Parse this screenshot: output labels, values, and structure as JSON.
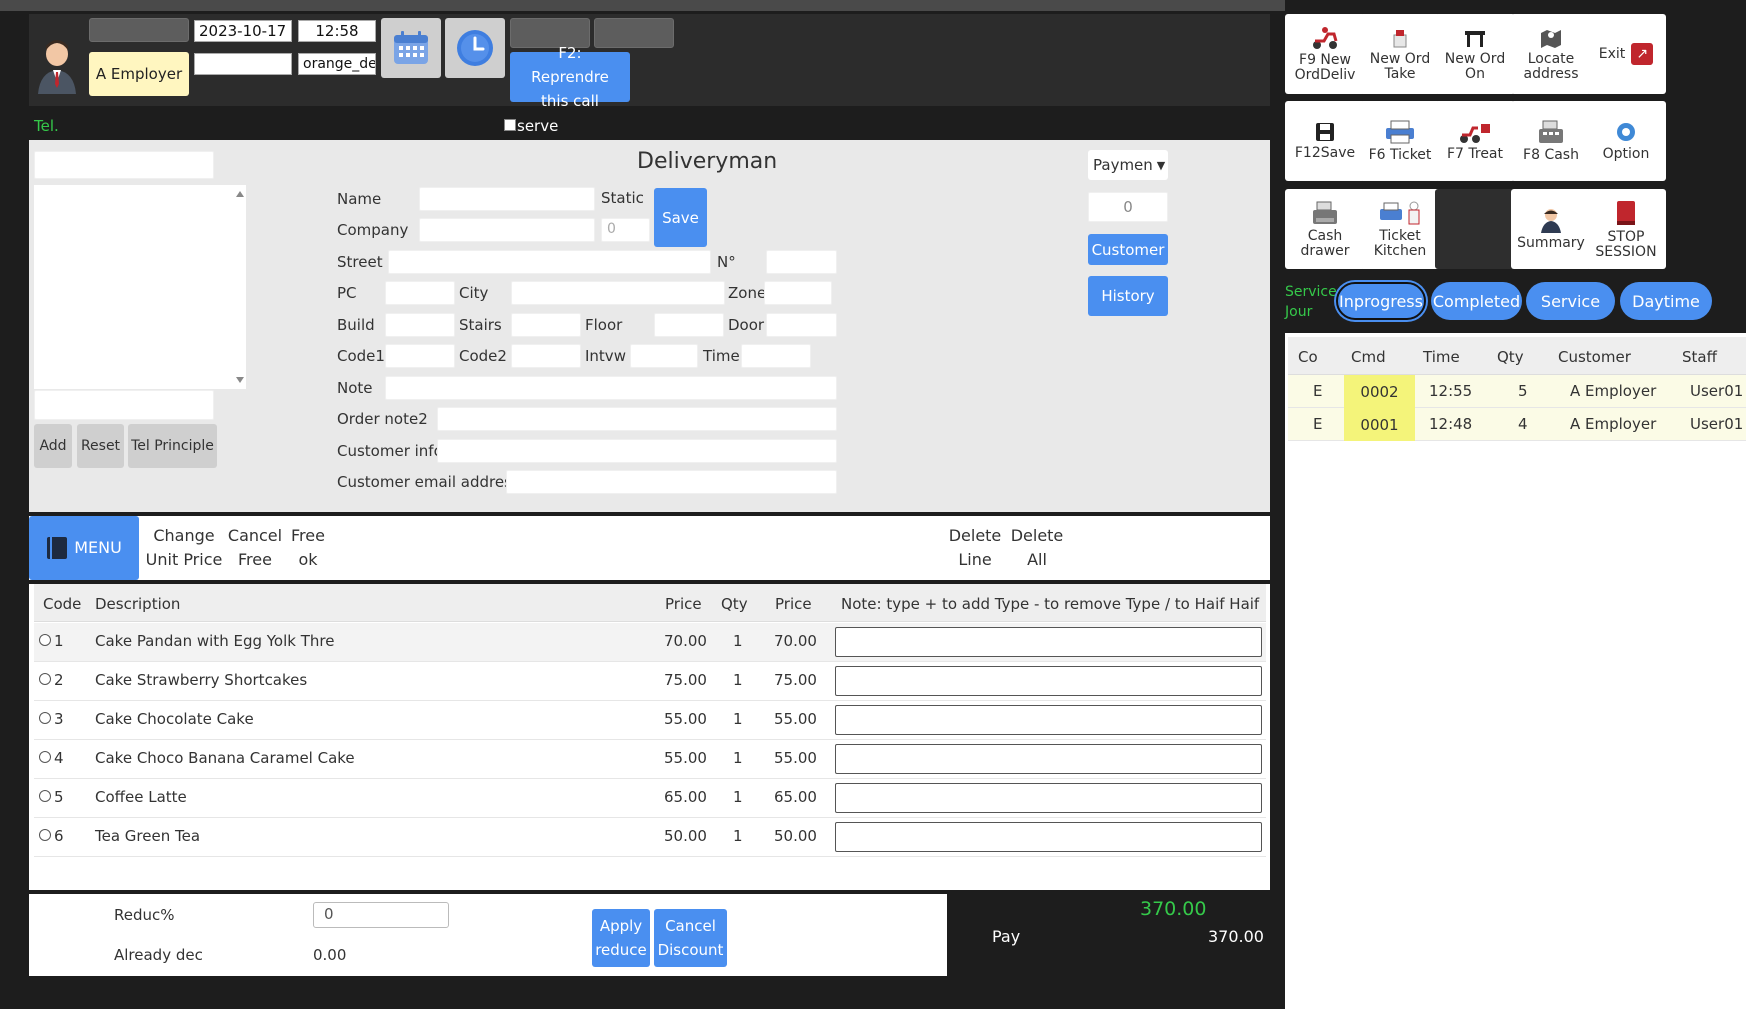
{
  "header": {
    "date": "2023-10-17",
    "time": "12:58",
    "employer": "A Employer",
    "source_value": "orange_de",
    "f2_label": "F2: Reprendre this call"
  },
  "phone": {
    "label": "Tel.",
    "reserve_label": "serve"
  },
  "form": {
    "title": "Deliveryman",
    "name_label": "Name",
    "static_label": "Static",
    "save_label": "Save",
    "company_label": "Company",
    "static_value_placeholder": "0",
    "street_label": "Street",
    "number_label": "N°",
    "pc_label": "PC",
    "city_label": "City",
    "zone_label": "Zone",
    "build_label": "Build",
    "stairs_label": "Stairs",
    "floor_label": "Floor",
    "door_label": "Door",
    "code1_label": "Code1",
    "code2_label": "Code2",
    "intvw_label": "Intvw",
    "time_label": "Time",
    "note_label": "Note",
    "order_note2_label": "Order note2",
    "customer_info_label": "Customer info",
    "customer_email_label": "Customer email address",
    "payment_select": "Paymen",
    "payment_value": "0",
    "customer_btn": "Customer",
    "history_btn": "History",
    "add_btn": "Add",
    "reset_btn": "Reset",
    "tel_principle_btn": "Tel Principle"
  },
  "menubar": {
    "menu_label": "MENU",
    "change_unit_price": [
      "Change",
      "Unit Price"
    ],
    "cancel_free": [
      "Cancel",
      "Free"
    ],
    "free_ok": [
      "Free",
      "ok"
    ],
    "delete_line": [
      "Delete",
      "Line"
    ],
    "delete_all": [
      "Delete",
      "All"
    ]
  },
  "items_table": {
    "headers": [
      "Code",
      "Description",
      "Price",
      "Qty",
      "Price",
      "Note: type + to add Type - to remove Type / to Haif Haif"
    ],
    "rows": [
      {
        "code": "1",
        "desc": "Cake Pandan with Egg Yolk Thre",
        "price": "70.00",
        "qty": "1",
        "total": "70.00"
      },
      {
        "code": "2",
        "desc": "Cake Strawberry Shortcakes",
        "price": "75.00",
        "qty": "1",
        "total": "75.00"
      },
      {
        "code": "3",
        "desc": "Cake Chocolate Cake",
        "price": "55.00",
        "qty": "1",
        "total": "55.00"
      },
      {
        "code": "4",
        "desc": "Cake Choco Banana Caramel Cake",
        "price": "55.00",
        "qty": "1",
        "total": "55.00"
      },
      {
        "code": "5",
        "desc": "Coffee Latte",
        "price": "65.00",
        "qty": "1",
        "total": "65.00"
      },
      {
        "code": "6",
        "desc": "Tea Green Tea",
        "price": "50.00",
        "qty": "1",
        "total": "50.00"
      }
    ]
  },
  "discount": {
    "reduc_label": "Reduc%",
    "reduc_value": "0",
    "already_label": "Already dec",
    "already_value": "0.00",
    "apply_label": "Apply reduce",
    "cancel_label": "Cancel Discount"
  },
  "totals": {
    "total_green": "370.00",
    "pay_label": "Pay",
    "pay_value": "370.00"
  },
  "actions": {
    "row1": [
      "F9 New OrdDeliv",
      "New Ord Take",
      "New Ord On",
      "Locate address",
      "Exit"
    ],
    "row2": [
      "F12Save",
      "F6 Ticket",
      "F7 Treat",
      "F8 Cash",
      "Option"
    ],
    "row3": [
      "Cash drawer",
      "Ticket Kitchen",
      "",
      "Summary",
      "STOP SESSION"
    ]
  },
  "service": {
    "label1": "Service",
    "label2": "Jour",
    "tabs": [
      "Inprogress",
      "Completed",
      "Service",
      "Daytime"
    ]
  },
  "orders_table": {
    "headers": [
      "Co",
      "Cmd",
      "Time",
      "Qty",
      "Customer",
      "Staff"
    ],
    "rows": [
      {
        "co": "E",
        "cmd": "0002",
        "time": "12:55",
        "qty": "5",
        "customer": "A Employer",
        "staff": "User01"
      },
      {
        "co": "E",
        "cmd": "0001",
        "time": "12:48",
        "qty": "4",
        "customer": "A Employer",
        "staff": "User01"
      }
    ]
  },
  "colors": {
    "accent_blue": "#4a8ff0",
    "highlight_yellow": "#f4f47a",
    "green_total": "#35c94a"
  }
}
